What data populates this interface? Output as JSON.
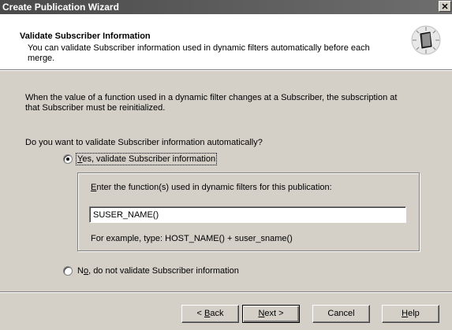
{
  "window": {
    "title": "Create Publication Wizard",
    "close_label": "✕"
  },
  "header": {
    "title": "Validate Subscriber Information",
    "description": "You can validate Subscriber information used in dynamic filters automatically before each merge."
  },
  "body": {
    "paragraph": "When the value of a function used in a dynamic filter changes at a Subscriber, the subscription at that Subscriber must be reinitialized.",
    "question": "Do you want to validate Subscriber information automatically?"
  },
  "option_yes": {
    "mnemonic": "Y",
    "rest": "es, validate Subscriber information",
    "selected": true
  },
  "group": {
    "label_mnemonic": "E",
    "label_rest": "nter the function(s) used in dynamic filters for this publication:",
    "input_value": "SUSER_NAME()",
    "example": "For example, type: HOST_NAME() + suser_sname()"
  },
  "option_no": {
    "label_pre": "N",
    "mnemonic": "o",
    "rest": ", do not validate Subscriber information",
    "selected": false
  },
  "buttons": {
    "back_pre": "< ",
    "back_mnemonic": "B",
    "back_rest": "ack",
    "next_mnemonic": "N",
    "next_rest": "ext >",
    "cancel": "Cancel",
    "help_mnemonic": "H",
    "help_rest": "elp"
  }
}
